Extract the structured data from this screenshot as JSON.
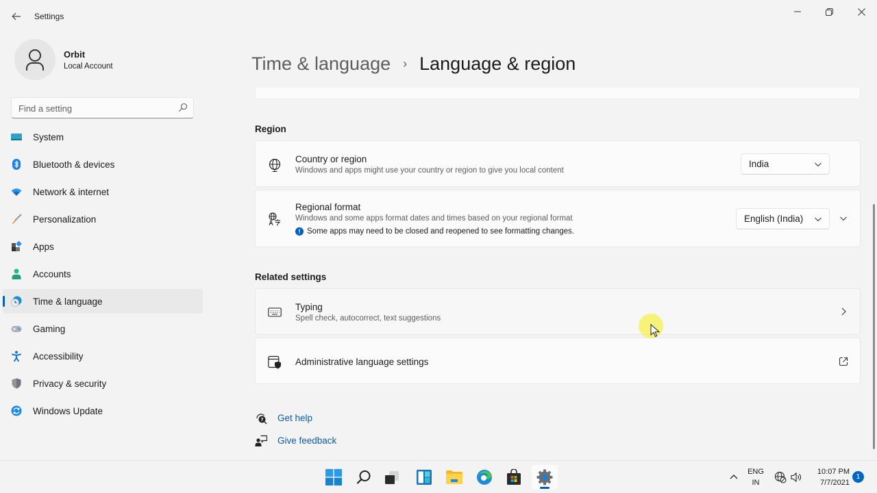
{
  "window": {
    "app_title": "Settings",
    "controls": {
      "minimize": "minimize",
      "maximize": "restore",
      "close": "close"
    }
  },
  "profile": {
    "name": "Orbit",
    "account_type": "Local Account"
  },
  "search": {
    "placeholder": "Find a setting",
    "value": ""
  },
  "sidebar": {
    "items": [
      {
        "label": "System",
        "icon": "monitor-icon",
        "active": false
      },
      {
        "label": "Bluetooth & devices",
        "icon": "bluetooth-icon",
        "active": false
      },
      {
        "label": "Network & internet",
        "icon": "wifi-icon",
        "active": false
      },
      {
        "label": "Personalization",
        "icon": "brush-icon",
        "active": false
      },
      {
        "label": "Apps",
        "icon": "apps-icon",
        "active": false
      },
      {
        "label": "Accounts",
        "icon": "person-icon",
        "active": false
      },
      {
        "label": "Time & language",
        "icon": "clock-globe-icon",
        "active": true
      },
      {
        "label": "Gaming",
        "icon": "gamepad-icon",
        "active": false
      },
      {
        "label": "Accessibility",
        "icon": "accessibility-icon",
        "active": false
      },
      {
        "label": "Privacy & security",
        "icon": "shield-icon",
        "active": false
      },
      {
        "label": "Windows Update",
        "icon": "update-icon",
        "active": false
      }
    ]
  },
  "breadcrumb": {
    "parent": "Time & language",
    "separator": "›",
    "current": "Language & region"
  },
  "region": {
    "title": "Region",
    "country": {
      "title": "Country or region",
      "description": "Windows and apps might use your country or region to give you local content",
      "selected": "India"
    },
    "format": {
      "title": "Regional format",
      "description": "Windows and some apps format dates and times based on your regional format",
      "note": "Some apps may need to be closed and reopened to see formatting changes.",
      "note_icon": "!",
      "selected": "English (India)"
    }
  },
  "related": {
    "title": "Related settings",
    "typing": {
      "title": "Typing",
      "description": "Spell check, autocorrect, text suggestions"
    },
    "admin": {
      "title": "Administrative language settings"
    }
  },
  "help": {
    "get_help": "Get help",
    "give_feedback": "Give feedback"
  },
  "taskbar": {
    "apps": [
      "start",
      "search",
      "task-view",
      "widgets",
      "file-explorer",
      "edge",
      "store",
      "settings"
    ],
    "active_app": "settings",
    "language": {
      "line1": "ENG",
      "line2": "IN"
    },
    "time": "10:07 PM",
    "date": "7/7/2021",
    "notification_count": "1"
  },
  "colors": {
    "accent": "#005fb8",
    "link": "#0f5aa6",
    "background": "#f3f3f3",
    "card": "#fbfbfb"
  }
}
